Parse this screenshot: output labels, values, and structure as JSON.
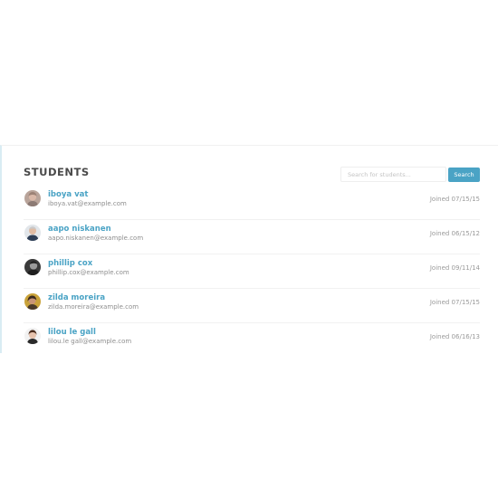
{
  "section": {
    "title": "STUDENTS",
    "search_placeholder": "Search for students...",
    "search_button_label": "Search"
  },
  "colors": {
    "accent": "#4aa3c5",
    "text_muted": "#8e8e8e",
    "divider": "#f1f1f1"
  },
  "students": [
    {
      "name": "iboya vat",
      "email": "iboya.vat@example.com",
      "joined": "Joined 07/15/15",
      "avatar_icon": "user-avatar"
    },
    {
      "name": "aapo niskanen",
      "email": "aapo.niskanen@example.com",
      "joined": "Joined 06/15/12",
      "avatar_icon": "user-avatar"
    },
    {
      "name": "phillip cox",
      "email": "phillip.cox@example.com",
      "joined": "Joined 09/11/14",
      "avatar_icon": "user-avatar"
    },
    {
      "name": "zilda moreira",
      "email": "zilda.moreira@example.com",
      "joined": "Joined 07/15/15",
      "avatar_icon": "user-avatar"
    },
    {
      "name": "lilou le gall",
      "email": "lilou.le gall@example.com",
      "joined": "Joined 06/16/13",
      "avatar_icon": "user-avatar"
    }
  ]
}
